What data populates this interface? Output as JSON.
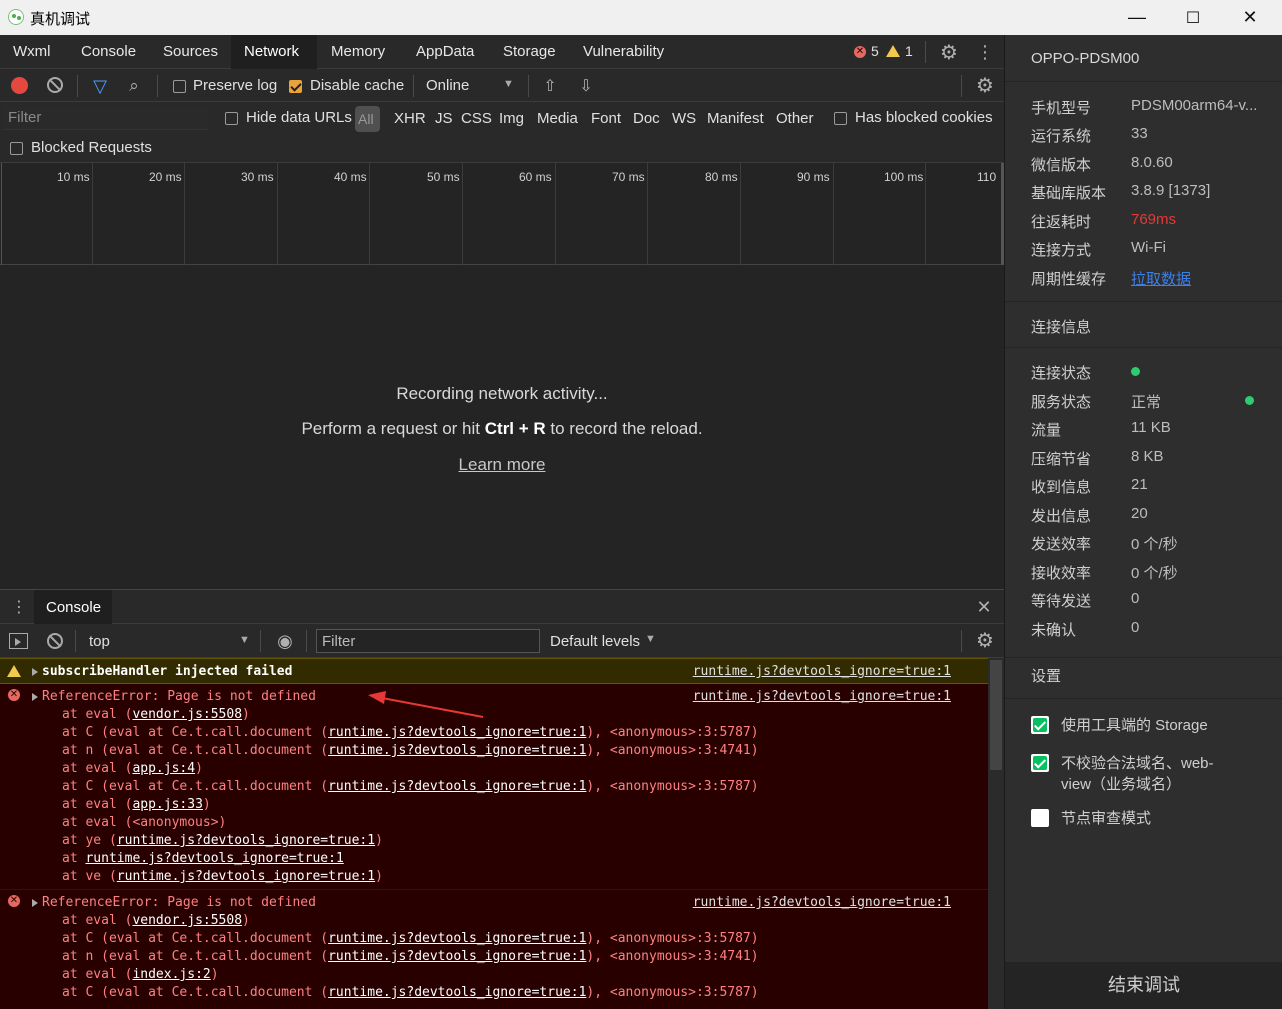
{
  "window": {
    "title": "真机调试",
    "minimize": "—",
    "maximize": "☐",
    "close": "✕"
  },
  "tabs": [
    "Wxml",
    "Console",
    "Sources",
    "Network",
    "Memory",
    "AppData",
    "Storage",
    "Vulnerability"
  ],
  "status": {
    "errors": "5",
    "warnings": "1"
  },
  "network_toolbar": {
    "preserve_log": "Preserve log",
    "disable_cache": "Disable cache",
    "throttle": "Online"
  },
  "filter_bar": {
    "placeholder": "Filter",
    "hide_data_urls": "Hide data URLs",
    "types": [
      "All",
      "XHR",
      "JS",
      "CSS",
      "Img",
      "Media",
      "Font",
      "Doc",
      "WS",
      "Manifest",
      "Other"
    ],
    "has_blocked_cookies": "Has blocked cookies",
    "blocked_requests": "Blocked Requests"
  },
  "timeline": {
    "ticks": [
      "10 ms",
      "20 ms",
      "30 ms",
      "40 ms",
      "50 ms",
      "60 ms",
      "70 ms",
      "80 ms",
      "90 ms",
      "100 ms",
      "110"
    ]
  },
  "empty_state": {
    "line1": "Recording network activity...",
    "line2_pre": "Perform a request or hit ",
    "line2_key": "Ctrl + R",
    "line2_post": " to record the reload.",
    "learn_more": "Learn more"
  },
  "drawer": {
    "tab": "Console"
  },
  "console_toolbar": {
    "context": "top",
    "filter_placeholder": "Filter",
    "levels": "Default levels"
  },
  "console": {
    "warning": {
      "text": "subscribeHandler injected failed",
      "source": "runtime.js?devtools_ignore=true:1"
    },
    "error1": {
      "text": "ReferenceError: Page is not defined",
      "source": "runtime.js?devtools_ignore=true:1",
      "frames": [
        {
          "pre": "at eval (",
          "link": "vendor.js:5508",
          "post": ")"
        },
        {
          "pre": "at C (eval at Ce.t.call.document (",
          "link": "runtime.js?devtools_ignore=true:1",
          "post": "), <anonymous>:3:5787)"
        },
        {
          "pre": "at n (eval at Ce.t.call.document (",
          "link": "runtime.js?devtools_ignore=true:1",
          "post": "), <anonymous>:3:4741)"
        },
        {
          "pre": "at eval (",
          "link": "app.js:4",
          "post": ")"
        },
        {
          "pre": "at C (eval at Ce.t.call.document (",
          "link": "runtime.js?devtools_ignore=true:1",
          "post": "), <anonymous>:3:5787)"
        },
        {
          "pre": "at eval (",
          "link": "app.js:33",
          "post": ")"
        },
        {
          "pre": "at eval (<anonymous>)",
          "link": "",
          "post": ""
        },
        {
          "pre": "at ye (",
          "link": "runtime.js?devtools_ignore=true:1",
          "post": ")"
        },
        {
          "pre": "at ",
          "link": "runtime.js?devtools_ignore=true:1",
          "post": ""
        },
        {
          "pre": "at ve (",
          "link": "runtime.js?devtools_ignore=true:1",
          "post": ")"
        }
      ]
    },
    "error2": {
      "text": "ReferenceError: Page is not defined",
      "source": "runtime.js?devtools_ignore=true:1",
      "frames": [
        {
          "pre": "at eval (",
          "link": "vendor.js:5508",
          "post": ")"
        },
        {
          "pre": "at C (eval at Ce.t.call.document (",
          "link": "runtime.js?devtools_ignore=true:1",
          "post": "), <anonymous>:3:5787)"
        },
        {
          "pre": "at n (eval at Ce.t.call.document (",
          "link": "runtime.js?devtools_ignore=true:1",
          "post": "), <anonymous>:3:4741)"
        },
        {
          "pre": "at eval (",
          "link": "index.js:2",
          "post": ")"
        },
        {
          "pre": "at C (eval at Ce.t.call.document (",
          "link": "runtime.js?devtools_ignore=true:1",
          "post": "), <anonymous>:3:5787)"
        }
      ]
    }
  },
  "side": {
    "device": "OPPO-PDSM00",
    "info": [
      {
        "k": "手机型号",
        "v": "PDSM00arm64-v..."
      },
      {
        "k": "运行系统",
        "v": "33"
      },
      {
        "k": "微信版本",
        "v": "8.0.60"
      },
      {
        "k": "基础库版本",
        "v": "3.8.9 [1373]"
      },
      {
        "k": "往返耗时",
        "v": "769ms"
      },
      {
        "k": "连接方式",
        "v": "Wi-Fi"
      },
      {
        "k": "周期性缓存",
        "v": "拉取数据"
      }
    ],
    "conn_title": "连接信息",
    "conn": [
      {
        "k": "连接状态",
        "v": ""
      },
      {
        "k": "服务状态",
        "v": "正常"
      },
      {
        "k": "流量",
        "v": "11 KB"
      },
      {
        "k": "压缩节省",
        "v": "8 KB"
      },
      {
        "k": "收到信息",
        "v": "21"
      },
      {
        "k": "发出信息",
        "v": "20"
      },
      {
        "k": "发送效率",
        "v": "0 个/秒"
      },
      {
        "k": "接收效率",
        "v": "0 个/秒"
      },
      {
        "k": "等待发送",
        "v": "0"
      },
      {
        "k": "未确认",
        "v": "0"
      }
    ],
    "settings_title": "设置",
    "settings": [
      {
        "label": "使用工具端的 Storage",
        "checked": true
      },
      {
        "label": "不校验合法域名、web-",
        "label2": "view（业务域名）",
        "checked": true
      },
      {
        "label": "节点审查模式",
        "checked": false
      }
    ],
    "end_button": "结束调试",
    "colors": {
      "rtt": "#e53935",
      "link": "#3d7fe8",
      "ok": "#2ecc71"
    }
  }
}
